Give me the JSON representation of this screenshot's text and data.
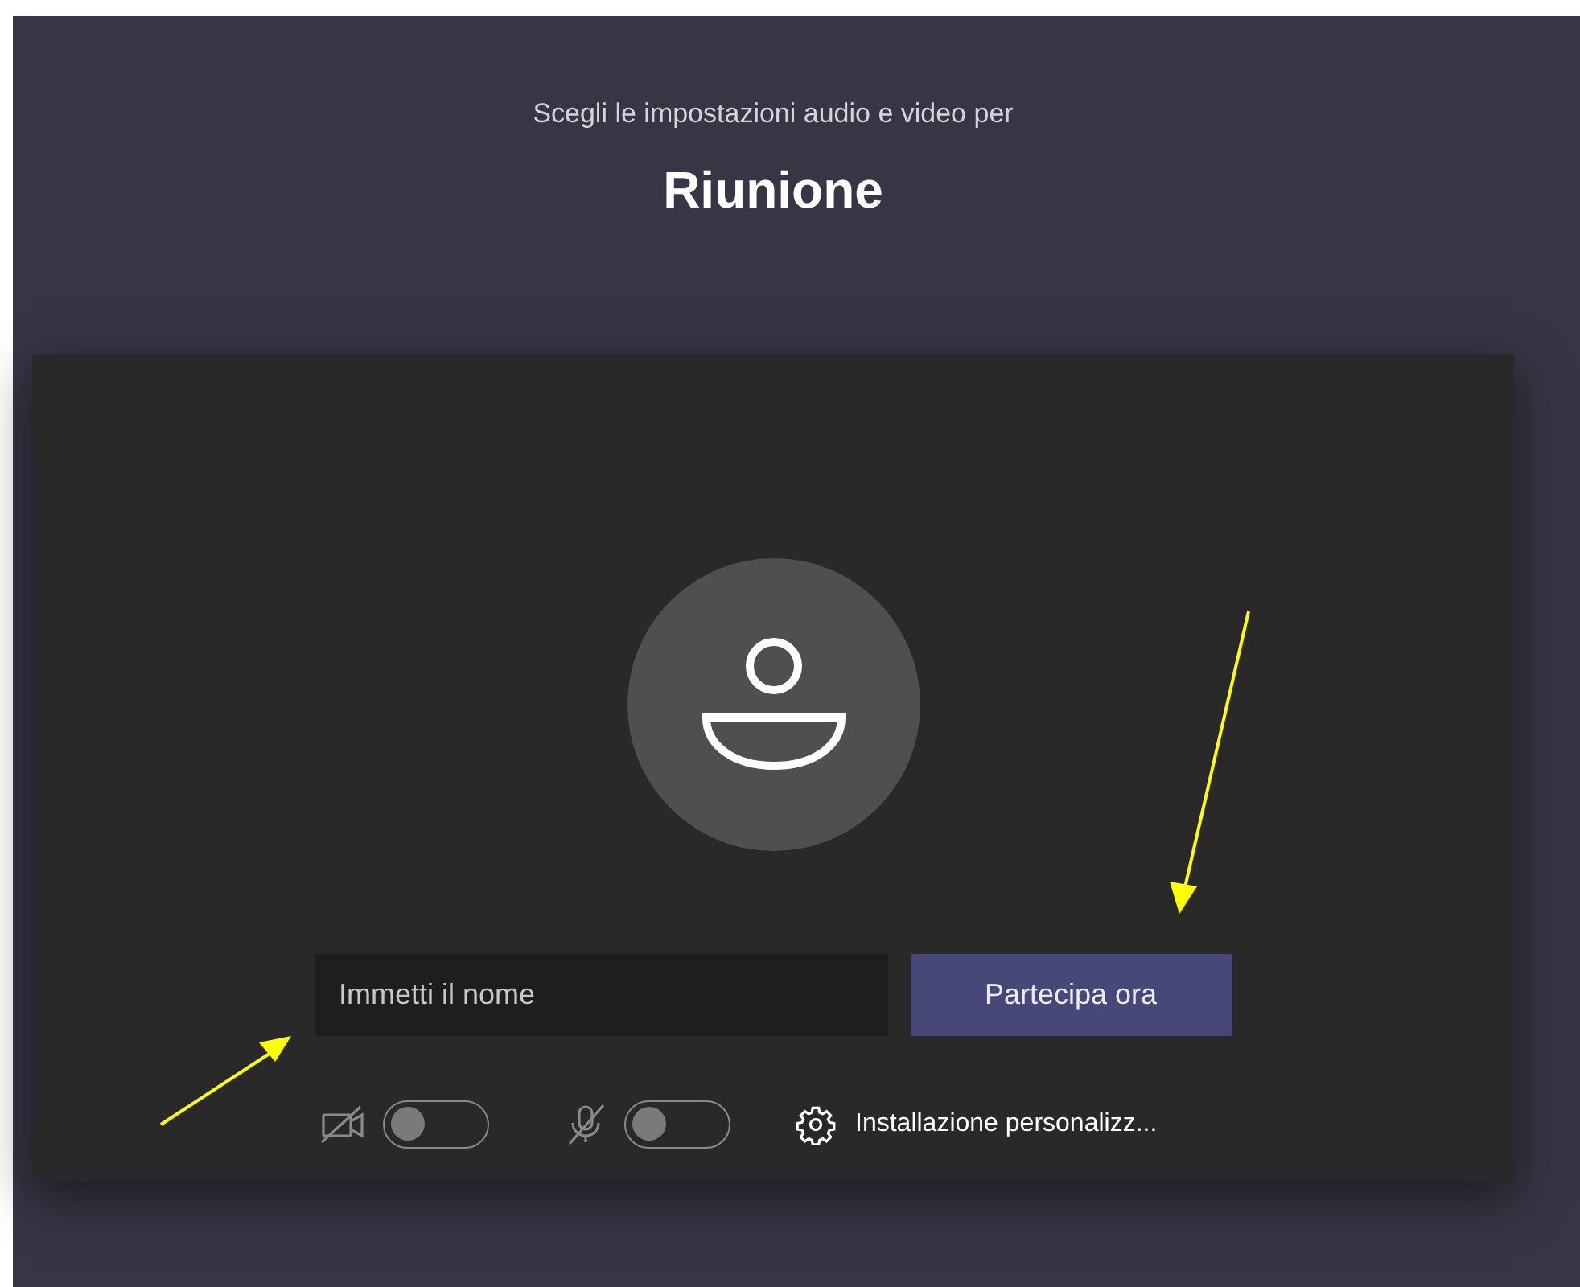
{
  "header": {
    "subtitle": "Scegli le impostazioni audio e video per",
    "title": "Riunione"
  },
  "name_field": {
    "placeholder": "Immetti il nome"
  },
  "join_button": "Partecipa ora",
  "toggles": [
    {
      "kind": "camera",
      "on": false
    },
    {
      "kind": "microphone",
      "on": false
    }
  ],
  "settings_link": "Installazione personalizz..."
}
